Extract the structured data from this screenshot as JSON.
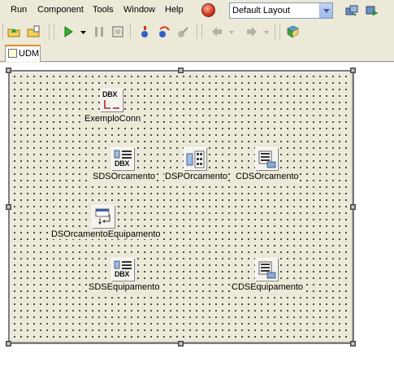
{
  "menu": {
    "items": [
      "Run",
      "Component",
      "Tools",
      "Window",
      "Help"
    ]
  },
  "layout_combo": {
    "value": "Default Layout"
  },
  "tabs": [
    {
      "label": "UDM"
    }
  ],
  "components": [
    {
      "label": "ExemploConn",
      "icon": "dbx-connection-icon"
    },
    {
      "label": "SDSOrcamento",
      "icon": "sql-dataset-icon"
    },
    {
      "label": "DSPOrcamento",
      "icon": "dataset-provider-icon"
    },
    {
      "label": "CDSOrcamento",
      "icon": "client-dataset-icon"
    },
    {
      "label": "DSOrcamentoEquipamento",
      "icon": "datasource-icon"
    },
    {
      "label": "SDSEquipamento",
      "icon": "sql-dataset-icon"
    },
    {
      "label": "CDSEquipamento",
      "icon": "client-dataset-icon"
    }
  ],
  "icon_text": {
    "dbx": "DBX"
  }
}
